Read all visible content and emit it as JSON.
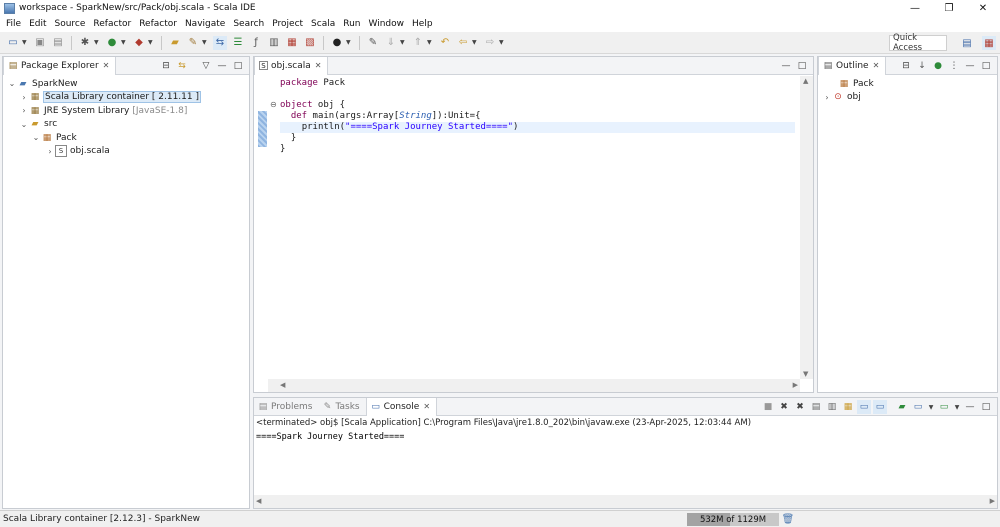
{
  "window": {
    "title": "workspace - SparkNew/src/Pack/obj.scala - Scala IDE",
    "minimize_glyph": "—",
    "maximize_glyph": "❐",
    "close_glyph": "✕"
  },
  "menu": [
    "File",
    "Edit",
    "Source",
    "Refactor",
    "Refactor",
    "Navigate",
    "Search",
    "Project",
    "Scala",
    "Run",
    "Window",
    "Help"
  ],
  "toolbar": {
    "quick_access_placeholder": "Quick Access"
  },
  "package_explorer": {
    "tab_label": "Package Explorer",
    "tree": {
      "project": "SparkNew",
      "scala_library": "Scala Library container [ 2.11.11 ]",
      "jre_library": "JRE System Library",
      "jre_version": "[JavaSE-1.8]",
      "src": "src",
      "package": "Pack",
      "file": "obj.scala"
    }
  },
  "editor": {
    "tab_label": "obj.scala",
    "lines": [
      "package Pack",
      "",
      "object obj {",
      "  def main(args:Array[String]):Unit={",
      "    println(\"====Spark Journey Started====\")",
      "  }",
      "}"
    ],
    "tokens": {
      "package_kw": "package",
      "package_name": " Pack",
      "object_kw": "object",
      "object_name": " obj {",
      "def_kw": "def",
      "main_sig_a": " main(args:Array[",
      "main_sig_type": "String",
      "main_sig_b": "]):Unit={",
      "println_a": "println(",
      "println_str": "\"====Spark Journey Started====\"",
      "println_b": ")",
      "close_inner": "}",
      "close_outer": "}"
    }
  },
  "outline": {
    "tab_label": "Outline",
    "items": [
      "Pack",
      "obj"
    ]
  },
  "bottom_panel": {
    "tabs": [
      "Problems",
      "Tasks",
      "Console"
    ],
    "console_header": "<terminated> obj$ [Scala Application] C:\\Program Files\\Java\\jre1.8.0_202\\bin\\javaw.exe (23-Apr-2025, 12:03:44 AM)",
    "console_output": "====Spark Journey Started===="
  },
  "status": {
    "left_text": "Scala Library container [2.12.3] - SparkNew",
    "heap_text": "532M of 1129M",
    "heap_used_fraction": 0.47
  }
}
